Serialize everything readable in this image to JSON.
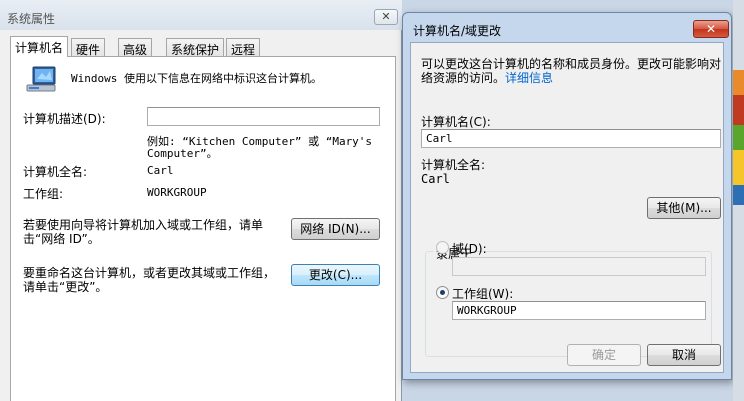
{
  "system_properties": {
    "title": "系统属性",
    "close_label": "✕",
    "tabs": [
      {
        "label": "计算机名"
      },
      {
        "label": "硬件"
      },
      {
        "label": "高级"
      },
      {
        "label": "系统保护"
      },
      {
        "label": "远程"
      }
    ],
    "intro": "Windows 使用以下信息在网络中标识这台计算机。",
    "description_label": "计算机描述(D):",
    "description_value": "",
    "example_line1": "例如: “Kitchen Computer” 或 “Mary's",
    "example_line2": "Computer”。",
    "full_name_label": "计算机全名:",
    "full_name_value": "Carl",
    "workgroup_label": "工作组:",
    "workgroup_value": "WORKGROUP",
    "network_id_text_line1": "若要使用向导将计算机加入域或工作组，请单",
    "network_id_text_line2": "击“网络 ID”。",
    "network_id_button": "网络 ID(N)...",
    "change_text_line1": "要重命名这台计算机，或者更改其域或工作组，",
    "change_text_line2": "请单击“更改”。",
    "change_button": "更改(C)..."
  },
  "name_change_dialog": {
    "title": "计算机名/域更改",
    "close_label": "✕",
    "intro_line1": "可以更改这台计算机的名称和成员身份。更改可能影响对",
    "intro_line2_prefix": "络资源的访问。",
    "details_link": "详细信息",
    "computer_name_label": "计算机名(C):",
    "computer_name_value": "Carl",
    "full_name_label": "计算机全名:",
    "full_name_value": "Carl",
    "more_button": "其他(M)...",
    "member_of_label": "隶属于",
    "domain_label": "域(D):",
    "domain_value": "",
    "domain_selected": false,
    "workgroup_label": "工作组(W):",
    "workgroup_value": "WORKGROUP",
    "workgroup_selected": true,
    "ok_button": "确定",
    "cancel_button": "取消"
  },
  "colors": {
    "accent_focus": "#3c7fb1",
    "link": "#0066cc",
    "close_red": "#c2341b"
  }
}
